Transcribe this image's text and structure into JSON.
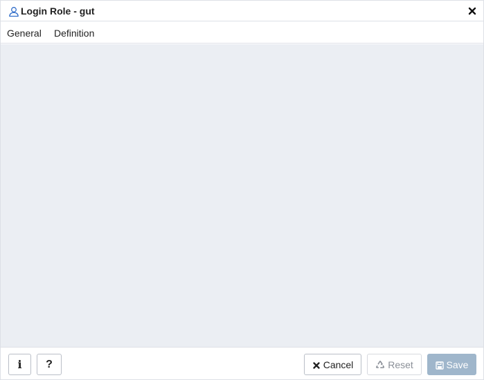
{
  "dialog": {
    "title": "Login Role - gut",
    "title_icon": "user-icon",
    "close_icon": "close-icon"
  },
  "tabs": [
    {
      "label": "General"
    },
    {
      "label": "Definition"
    }
  ],
  "footer": {
    "info_glyph": "i",
    "help_glyph": "?",
    "cancel_label": "Cancel",
    "reset_label": "Reset",
    "save_label": "Save"
  },
  "colors": {
    "content_bg": "#ebeef3",
    "save_disabled_bg": "#9fb6cb",
    "user_icon": "#326ec9"
  }
}
